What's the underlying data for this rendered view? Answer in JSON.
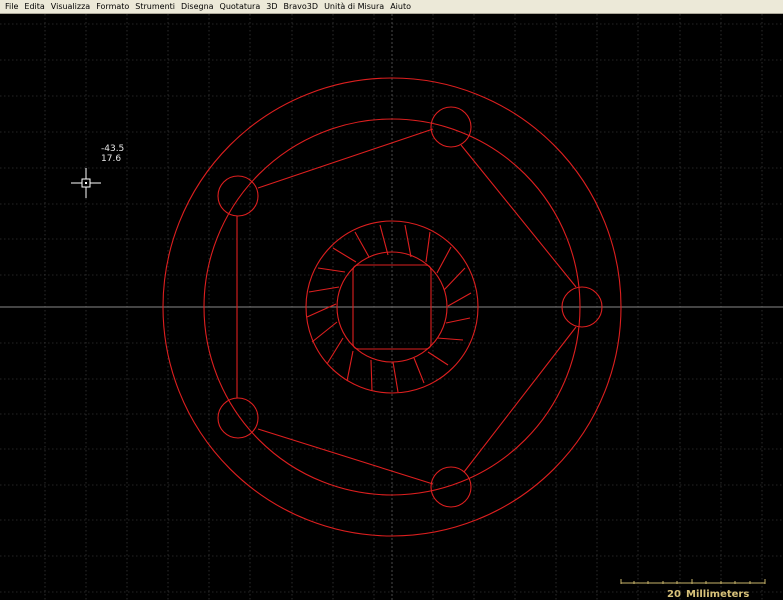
{
  "menubar": {
    "items": [
      "File",
      "Edita",
      "Visualizza",
      "Formato",
      "Strumenti",
      "Disegna",
      "Quotatura",
      "3D",
      "Bravo3D",
      "Unità di Misura",
      "Aiuto"
    ]
  },
  "cursor": {
    "x_readout": "-43.5",
    "y_readout": "17.6"
  },
  "scale_bar": {
    "value": "20",
    "unit": "Millimeters"
  },
  "colors": {
    "background": "#000000",
    "grid": "#4a4a4a",
    "drawing": "#dd1f1f",
    "axis": "#b4b4b4",
    "cursor": "#ffffff",
    "scale_bar": "#c8b46a",
    "scale_text": "#d8c27a"
  }
}
